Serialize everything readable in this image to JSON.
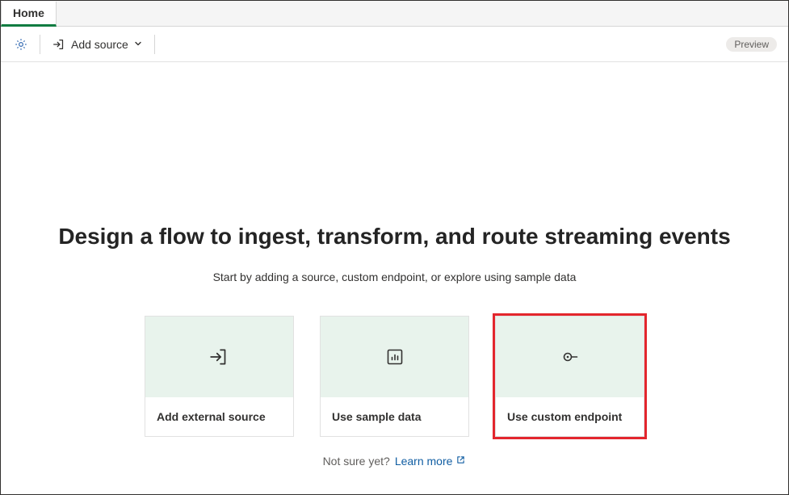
{
  "tabs": {
    "home": "Home"
  },
  "commandBar": {
    "addSourceLabel": "Add source",
    "previewBadge": "Preview"
  },
  "hero": {
    "title": "Design a flow to ingest, transform, and route streaming events",
    "subtitle": "Start by adding a source, custom endpoint, or explore using sample data"
  },
  "cards": [
    {
      "label": "Add external source"
    },
    {
      "label": "Use sample data"
    },
    {
      "label": "Use custom endpoint"
    }
  ],
  "helper": {
    "notSure": "Not sure yet?",
    "learnMore": "Learn more"
  }
}
